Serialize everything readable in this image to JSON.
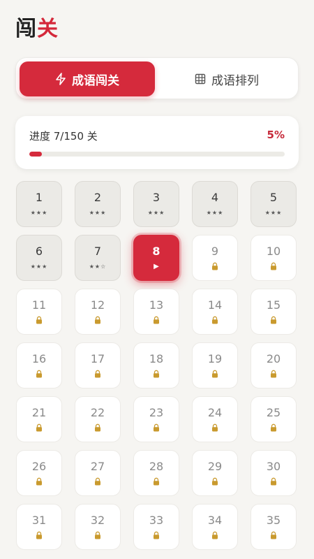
{
  "page": {
    "title_main": "闯",
    "title_accent": "关"
  },
  "tabs": [
    {
      "label": "成语闯关",
      "icon": "lightning-icon",
      "active": true
    },
    {
      "label": "成语排列",
      "icon": "grid-icon",
      "active": false
    }
  ],
  "progress": {
    "label": "进度 7/150 关",
    "percent_text": "5%",
    "fraction": 0.05
  },
  "colors": {
    "accent": "#d52a3c",
    "lock": "#c99a2e"
  },
  "levels": [
    {
      "num": "1",
      "state": "done",
      "stars": "★★★"
    },
    {
      "num": "2",
      "state": "done",
      "stars": "★★★"
    },
    {
      "num": "3",
      "state": "done",
      "stars": "★★★"
    },
    {
      "num": "4",
      "state": "done",
      "stars": "★★★"
    },
    {
      "num": "5",
      "state": "done",
      "stars": "★★★"
    },
    {
      "num": "6",
      "state": "done",
      "stars": "★★★"
    },
    {
      "num": "7",
      "state": "done",
      "stars": "★★☆"
    },
    {
      "num": "8",
      "state": "current",
      "stars": "▶"
    },
    {
      "num": "9",
      "state": "locked"
    },
    {
      "num": "10",
      "state": "locked"
    },
    {
      "num": "11",
      "state": "locked"
    },
    {
      "num": "12",
      "state": "locked"
    },
    {
      "num": "13",
      "state": "locked"
    },
    {
      "num": "14",
      "state": "locked"
    },
    {
      "num": "15",
      "state": "locked"
    },
    {
      "num": "16",
      "state": "locked"
    },
    {
      "num": "17",
      "state": "locked"
    },
    {
      "num": "18",
      "state": "locked"
    },
    {
      "num": "19",
      "state": "locked"
    },
    {
      "num": "20",
      "state": "locked"
    },
    {
      "num": "21",
      "state": "locked"
    },
    {
      "num": "22",
      "state": "locked"
    },
    {
      "num": "23",
      "state": "locked"
    },
    {
      "num": "24",
      "state": "locked"
    },
    {
      "num": "25",
      "state": "locked"
    },
    {
      "num": "26",
      "state": "locked"
    },
    {
      "num": "27",
      "state": "locked"
    },
    {
      "num": "28",
      "state": "locked"
    },
    {
      "num": "29",
      "state": "locked"
    },
    {
      "num": "30",
      "state": "locked"
    },
    {
      "num": "31",
      "state": "locked"
    },
    {
      "num": "32",
      "state": "locked"
    },
    {
      "num": "33",
      "state": "locked"
    },
    {
      "num": "34",
      "state": "locked"
    },
    {
      "num": "35",
      "state": "locked"
    }
  ]
}
